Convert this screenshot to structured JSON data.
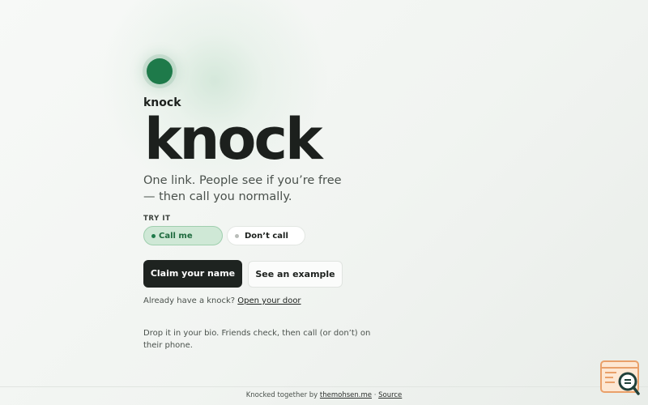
{
  "brand": {
    "small_name": "knock",
    "large_name": "knock",
    "accent_color": "#1e7a4a"
  },
  "hero": {
    "tagline": "One link. People see if you’re free — then call you normally."
  },
  "try_it": {
    "label": "TRY IT",
    "options": [
      {
        "label": "Call me",
        "selected": true
      },
      {
        "label": "Don’t call",
        "selected": false
      }
    ]
  },
  "actions": {
    "primary_label": "Claim your name",
    "secondary_label": "See an example"
  },
  "login": {
    "prompt": "Already have a knock?",
    "link_label": "Open your door"
  },
  "bio_text": "Drop it in your bio. Friends check, then call (or don’t) on their phone.",
  "footer": {
    "prefix": "Knocked together by",
    "author_link": "themohsen.me",
    "separator": "·",
    "source_link": "Source"
  },
  "icons": {
    "widget": "search-window-icon"
  }
}
